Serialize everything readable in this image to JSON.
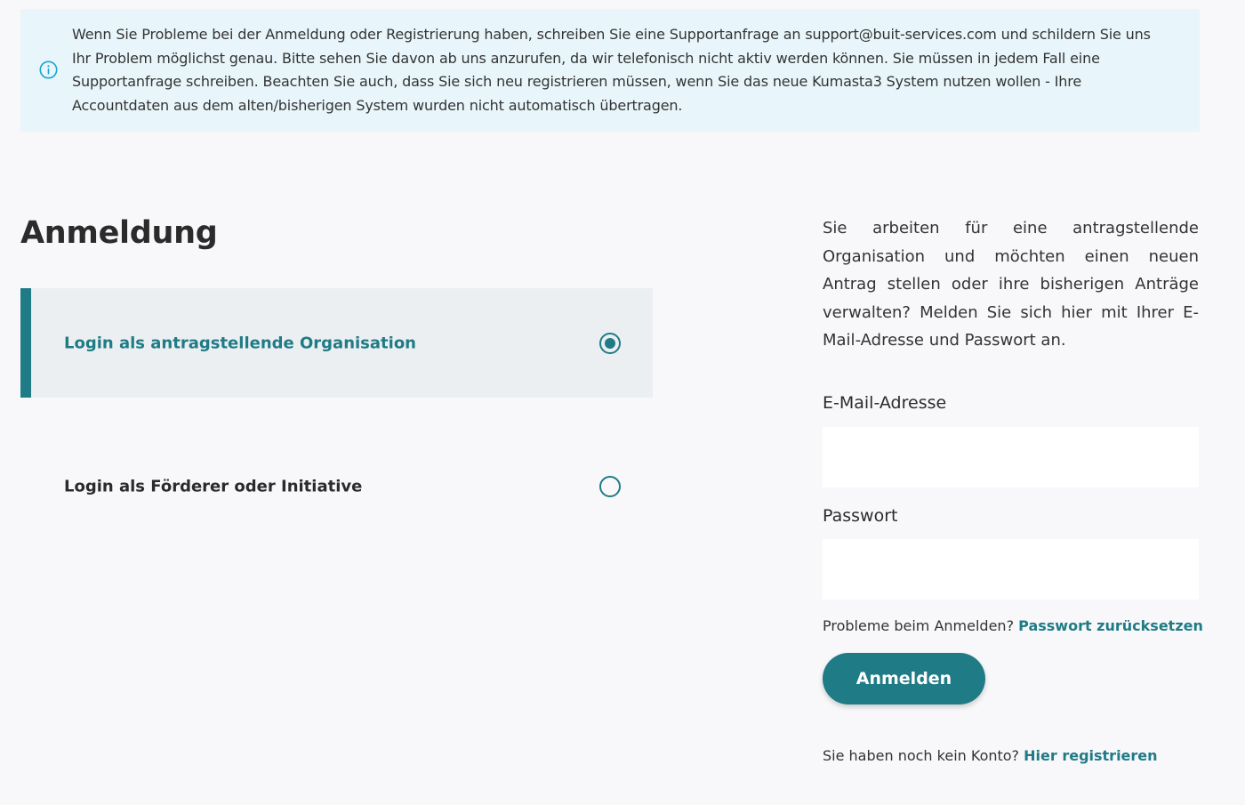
{
  "notice": {
    "icon": "info-icon",
    "text": "Wenn Sie Probleme bei der Anmeldung oder Registrierung haben, schreiben Sie eine Supportanfrage an support@buit-services.com und schildern Sie uns Ihr Problem möglichst genau. Bitte sehen Sie davon ab uns anzurufen, da wir telefonisch nicht aktiv werden können. Sie müssen in jedem Fall eine Supportanfrage schreiben. Beachten Sie auch, dass Sie sich neu registrieren müssen, wenn Sie das neue Kumasta3 System nutzen wollen - Ihre Accountdaten aus dem alten/bisherigen System wurden nicht automatisch übertragen."
  },
  "page_title": "Anmeldung",
  "login_options": [
    {
      "label": "Login als antragstellende Organisation",
      "selected": true
    },
    {
      "label": "Login als Förderer oder Initiative",
      "selected": false
    }
  ],
  "form": {
    "intro": "Sie arbeiten für eine antragstellende Organisation und möchten einen neuen Antrag stellen oder ihre bisherigen Anträge verwalten? Melden Sie sich hier mit Ihrer E-Mail-Adresse und Passwort an.",
    "email_label": "E-Mail-Adresse",
    "email_value": "",
    "password_label": "Passwort",
    "password_value": "",
    "problems_text": "Probleme beim Anmelden?",
    "reset_link": "Passwort zurücksetzen",
    "submit_label": "Anmelden",
    "no_account_text": "Sie haben noch kein Konto?",
    "register_link": "Hier registrieren"
  },
  "colors": {
    "accent": "#1f7b86",
    "notice_bg": "#e8f6fb",
    "info_icon": "#1aa3d0"
  }
}
